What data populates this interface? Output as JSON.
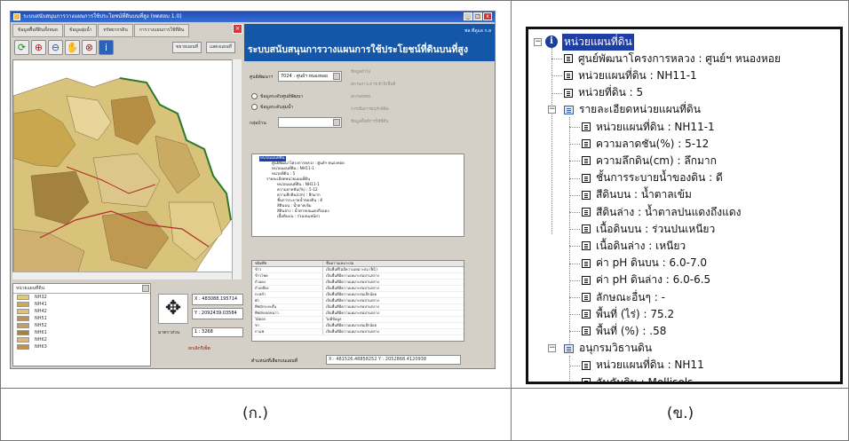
{
  "left_panel": {
    "caption": "(ก.)",
    "window_title": "ระบบสนับสนุนการวางแผนการใช้ประโยชน์ที่ดินบนที่สูง (ทดสอบ 1.0)",
    "tabs": [
      "ข้อมูลพื้นที่ดินทั้งหมด",
      "ข้อมูลลุ่มน้ำ",
      "ทรัพยากรดิน",
      "การวางแผนการใช้ที่ดิน"
    ],
    "toolbar_buttons": [
      "ขยายแผนที่",
      "แสดงแผนที่"
    ],
    "header_user": "พล.ที่ดูแล ก.ย",
    "header_title": "ระบบสนับสนุนการวางแผนการใช้ประโยชน์ที่ดินบนที่สูง",
    "center_combo": "7024 : ศูนย์ฯ หนองหอย",
    "center_label": "ศูนย์พัฒนาฯ",
    "radio_1": "ข้อมูลระดับศูนย์พัฒนา",
    "radio_2": "ข้อมูลระดับลุ่มน้ำ",
    "group_label": "กลุ่มบ้าน",
    "side_buttons": [
      "ข้อมูลทั่วไป",
      "สภาพภาวะการเข้าถึงพื้นที่",
      "สภาพสังคม",
      "การเพิ่มการอนุรักษ์ดิน",
      "ข้อมูลพื้นที่การใช้ที่ดิน"
    ],
    "mini_tree": [
      "หน่วยแผนที่ดิน",
      "ศูนย์พัฒนาโครงการหลวง : ศูนย์ฯ หนองหอย",
      "หน่วยแผนที่ดิน : NH11-1",
      "หน่วยที่ดิน : 5",
      "รายละเอียดหน่วยแผนที่ดิน",
      "หน่วยแผนที่ดิน : NH11-1",
      "ความลาดชัน(%) : 5-12",
      "ความลึกดิน(cm) : ลึกมาก",
      "ชั้นการระบายน้ำของดิน : ดี",
      "สีดินบน : น้ำตาลเข้ม",
      "สีดินล่าง : น้ำตาลปนแดงถึงแดง",
      "เนื้อดินบน : ร่วนปนเหนียว"
    ],
    "table_headers": [
      "ชนิดพืช",
      "ชั้นความเหมาะสม"
    ],
    "table_rows": [
      [
        "ข้าว",
        "เป็นพื้นที่ไม่มีความเหมาะสม (N1)"
      ],
      [
        "ข้าวโพด",
        "เป็นพื้นที่มีความเหมาะสมปานกลาง"
      ],
      [
        "ถั่วแดง",
        "เป็นพื้นที่มีความเหมาะสมปานกลาง"
      ],
      [
        "ถั่วเหลือง",
        "เป็นพื้นที่มีความเหมาะสมปานกลาง"
      ],
      [
        "กะหล่ำ",
        "เป็นพื้นที่มีความเหมาะสมเล็กน้อย"
      ],
      [
        "ผัก",
        "เป็นพื้นที่มีความเหมาะสมปานกลาง"
      ],
      [
        "พืชผักระยะสั้น",
        "เป็นพื้นที่มีความเหมาะสมปานกลาง"
      ],
      [
        "พืชผักเขตหนาว",
        "เป็นพื้นที่มีความเหมาะสมปานกลาง"
      ],
      [
        "ไม้ดอก",
        "ไม่มีข้อมูล"
      ],
      [
        "ชา",
        "เป็นพื้นที่มีความเหมาะสมเล็กน้อย"
      ],
      [
        "กาแฟ",
        "เป็นพื้นที่มีความเหมาะสมปานกลาง"
      ]
    ],
    "status_label": "ตำแหน่งที่เลือกบนแผนที่",
    "status_value": "X : 481526.48858252  Y : 2052868.4120938",
    "legend_header": "หน่วยแผนที่ดิน",
    "legend_items": [
      {
        "label": "NH32",
        "color": "#e3c970"
      },
      {
        "label": "NH41",
        "color": "#c9a860"
      },
      {
        "label": "NH42",
        "color": "#d7c47a"
      },
      {
        "label": "NH51",
        "color": "#b89456"
      },
      {
        "label": "NH52",
        "color": "#c0a06a"
      },
      {
        "label": "NH61",
        "color": "#a8803e"
      },
      {
        "label": "NH62",
        "color": "#d9b87a"
      },
      {
        "label": "NH63",
        "color": "#c09048"
      }
    ],
    "coord_x": "X : 483088.195714",
    "coord_y": "Y : 2092439.03584",
    "scale_label": "มาตราส่วน",
    "scale_value": "1 : 3268",
    "red_label": "ยกเลิกรีเซ็ต"
  },
  "right_panel": {
    "caption": "(ข.)",
    "root": "หน่วยแผนที่ดิน",
    "items": [
      "ศูนย์พัฒนาโครงการหลวง : ศูนย์ฯ หนองหอย",
      "หน่วยแผนที่ดิน : NH11-1",
      "หน่วยที่ดิน : 5"
    ],
    "group1": "รายละเอียดหน่วยแผนที่ดิน",
    "group1_items": [
      "หน่วยแผนที่ดิน : NH11-1",
      "ความลาดชัน(%) : 5-12",
      "ความลึกดิน(cm) : ลึกมาก",
      "ชั้นการระบายน้ำของดิน : ดี",
      "สีดินบน : น้ำตาลเข้ม",
      "สีดินล่าง : น้ำตาลปนแดงถึงแดง",
      "เนื้อดินบน : ร่วนปนเหนียว",
      "เนื้อดินล่าง : เหนียว",
      "ค่า pH ดินบน : 6.0-7.0",
      "ค่า pH ดินล่าง : 6.0-6.5",
      "ลักษณะอื่นๆ : -",
      "พื้นที่ (ไร่) : 75.2",
      "พื้นที่ (%) : .58"
    ],
    "group2": "อนุกรมวิธานดิน",
    "group2_items": [
      "หน่วยแผนที่ดิน : NH11",
      "อันดับดิน : Mollisols"
    ]
  }
}
